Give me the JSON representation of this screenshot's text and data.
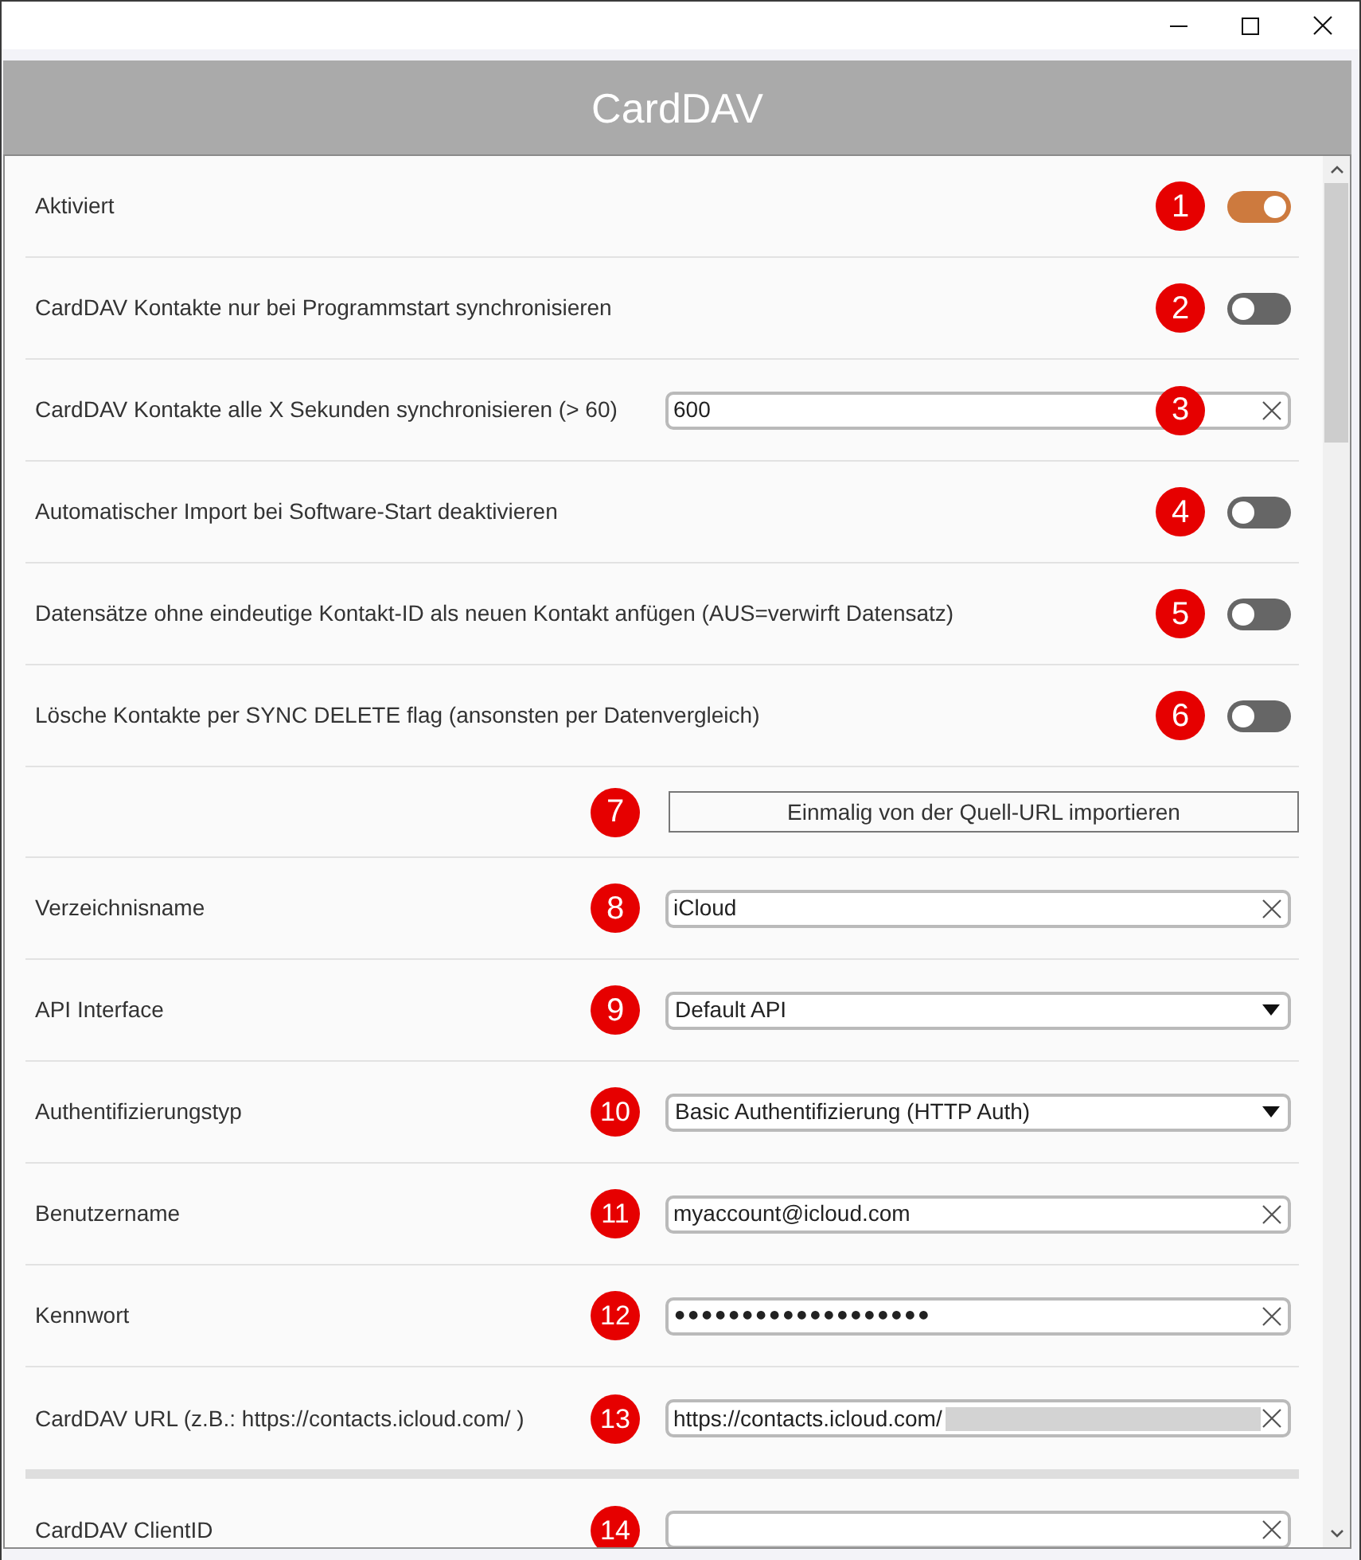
{
  "panel": {
    "title": "CardDAV"
  },
  "sections": [
    {
      "rows": [
        {
          "kind": "toggle",
          "label": "Aktiviert",
          "marker": "1",
          "on": true
        },
        {
          "kind": "toggle",
          "label": "CardDAV Kontakte nur bei Programmstart synchronisieren",
          "marker": "2",
          "on": false
        },
        {
          "kind": "text",
          "label": "CardDAV Kontakte alle X Sekunden synchronisieren (> 60)",
          "marker": "3",
          "value": "600"
        },
        {
          "kind": "toggle",
          "label": "Automatischer Import bei Software-Start deaktivieren",
          "marker": "4",
          "on": false
        },
        {
          "kind": "toggle",
          "label": "Datensätze ohne eindeutige Kontakt-ID als neuen Kontakt anfügen (AUS=verwirft Datensatz)",
          "marker": "5",
          "on": false
        },
        {
          "kind": "toggle",
          "label": "Lösche Kontakte per SYNC DELETE flag (ansonsten per Datenvergleich)",
          "marker": "6",
          "on": false
        },
        {
          "kind": "button",
          "marker": "7",
          "button": "Einmalig von der Quell-URL importieren"
        },
        {
          "kind": "text",
          "label": "Verzeichnisname",
          "marker": "8",
          "value": "iCloud"
        },
        {
          "kind": "select",
          "label": "API Interface",
          "marker": "9",
          "value": "Default API"
        },
        {
          "kind": "select",
          "label": "Authentifizierungstyp",
          "marker": "10",
          "value": "Basic Authentifizierung (HTTP Auth)"
        },
        {
          "kind": "text",
          "label": "Benutzername",
          "marker": "11",
          "value": "myaccount@icloud.com"
        },
        {
          "kind": "password",
          "label": "Kennwort",
          "marker": "12",
          "value": "●●●●●●●●●●●●●●●●●●●"
        },
        {
          "kind": "text",
          "label": "CardDAV URL (z.B.: https://contacts.icloud.com/ )",
          "marker": "13",
          "value": "https://contacts.icloud.com/",
          "redacted": true
        }
      ]
    },
    {
      "rows": [
        {
          "kind": "text",
          "label": "CardDAV ClientID",
          "marker": "14"
        }
      ]
    }
  ]
}
